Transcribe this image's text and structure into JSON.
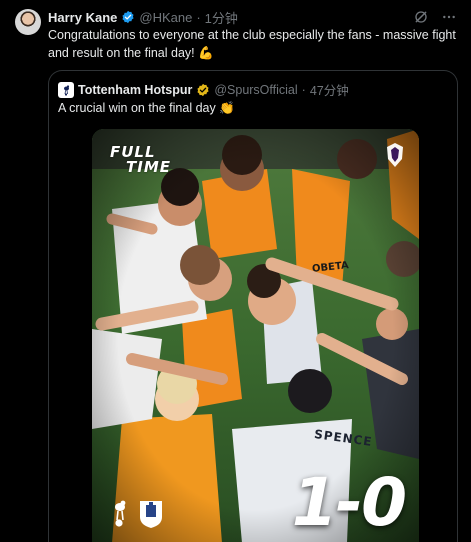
{
  "tweet": {
    "author_name": "Harry Kane",
    "handle": "@HKane",
    "separator": "·",
    "time": "1分钟",
    "text": "Congratulations to everyone at the club especially the fans - massive fight and result on the final day! 💪"
  },
  "quoted_tweet": {
    "author_name": "Tottenham Hotspur",
    "handle": "@SpursOfficial",
    "separator": "·",
    "time": "47分钟",
    "text": "A crucial win on the final day 👏",
    "media": {
      "graphic_title_line1": "FULL",
      "graphic_title_line2": "TIME",
      "score": "1-0",
      "shirt_name": "SPENCE",
      "vest_text": "OBETA"
    }
  },
  "icons": {
    "verified": "verified-badge-icon",
    "grok": "grok-icon",
    "more": "more-icon",
    "spurs_avatar": "cockerel-icon"
  },
  "colors": {
    "background": "#000000",
    "text_primary": "#e7e9ea",
    "text_secondary": "#71767b",
    "verified_blue": "#1d9bf0",
    "verified_gold": "#e2b719",
    "border": "#2f3336",
    "vest_orange": "#f08a1c"
  }
}
